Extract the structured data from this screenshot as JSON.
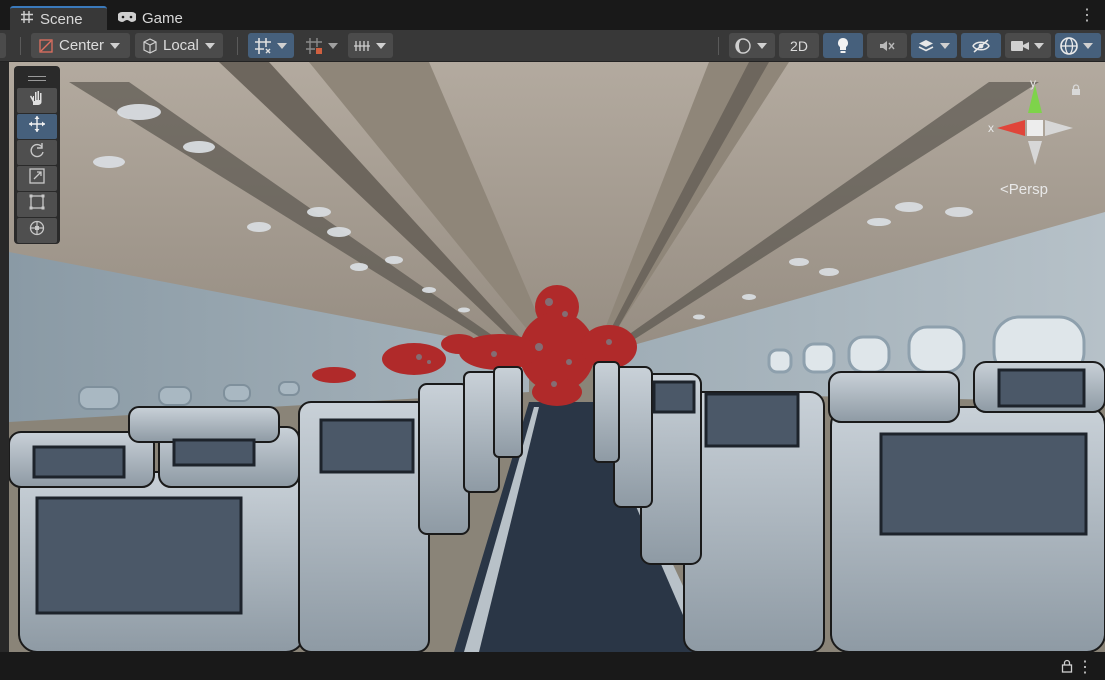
{
  "tabs": [
    {
      "label": "Scene",
      "icon": "grid-icon",
      "active": true
    },
    {
      "label": "Game",
      "icon": "gamepad-icon",
      "active": false
    }
  ],
  "toolbar": {
    "pivot_label": "Center",
    "space_label": "Local",
    "mode_2d_label": "2D"
  },
  "overlay": {
    "persp_label": "Persp",
    "axis_x": "x",
    "axis_y": "y"
  },
  "tools": [
    "hand-tool",
    "move-tool",
    "rotate-tool",
    "scale-tool",
    "rect-tool",
    "transform-tool"
  ],
  "colors": {
    "accent": "#3a79bb",
    "active_button": "#46607c",
    "x_axis": "#e0453a",
    "y_axis": "#7ed34a"
  }
}
